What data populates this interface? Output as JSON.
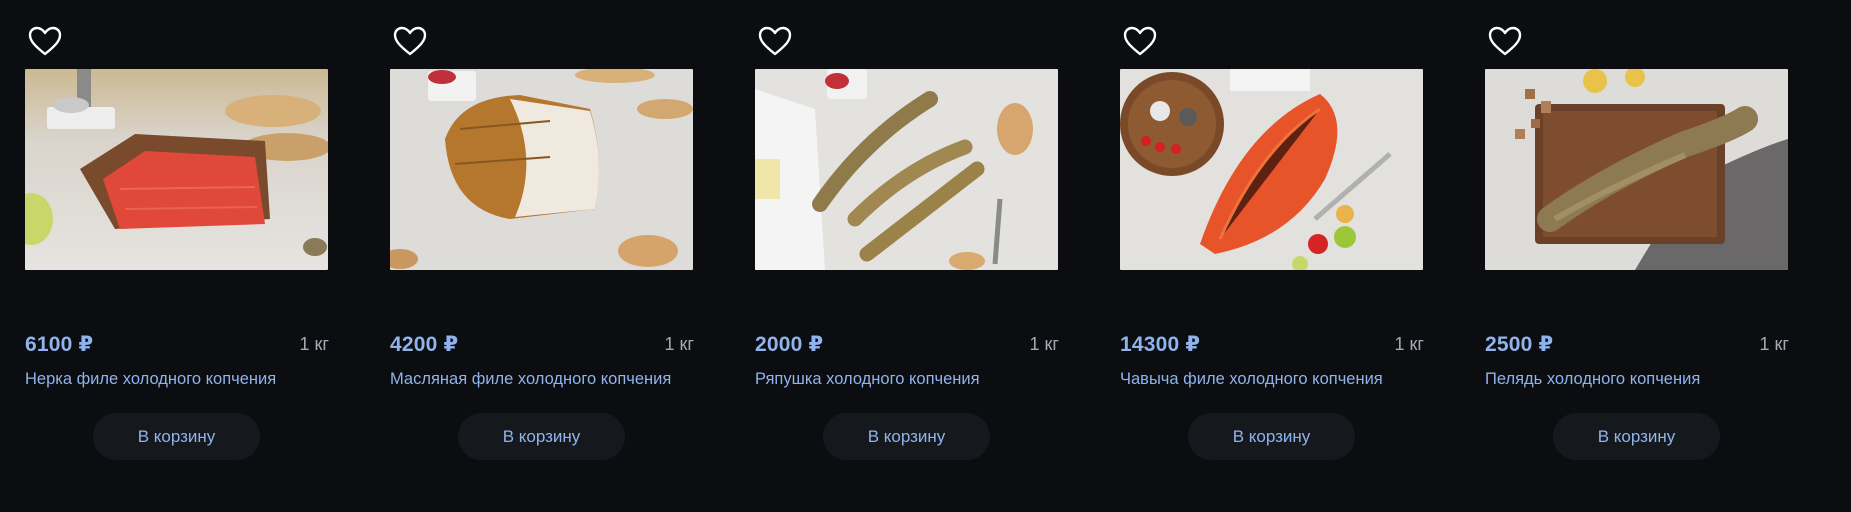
{
  "products": [
    {
      "price": "6100 ₽",
      "weight": "1 кг",
      "title": "Нерка филе холодного копчения",
      "cart_label": "В корзину",
      "image_alt": "Нерка филе холодного копчения"
    },
    {
      "price": "4200 ₽",
      "weight": "1 кг",
      "title": "Масляная филе холодного копчения",
      "cart_label": "В корзину",
      "image_alt": "Масляная филе холодного копчения"
    },
    {
      "price": "2000 ₽",
      "weight": "1 кг",
      "title": "Ряпушка холодного копчения",
      "cart_label": "В корзину",
      "image_alt": "Ряпушка холодного копчения"
    },
    {
      "price": "14300 ₽",
      "weight": "1 кг",
      "title": "Чавыча филе холодного копчения",
      "cart_label": "В корзину",
      "image_alt": "Чавыча филе холодного копчения"
    },
    {
      "price": "2500 ₽",
      "weight": "1 кг",
      "title": "Пелядь холодного копчения",
      "cart_label": "В корзину",
      "image_alt": "Пелядь холодного копчения"
    }
  ],
  "icons": {
    "favorite": "heart-outline-icon"
  },
  "colors": {
    "background": "#0b0d10",
    "accent": "#8fb4ec",
    "button_bg": "#15191e",
    "muted": "#a5aab2"
  }
}
